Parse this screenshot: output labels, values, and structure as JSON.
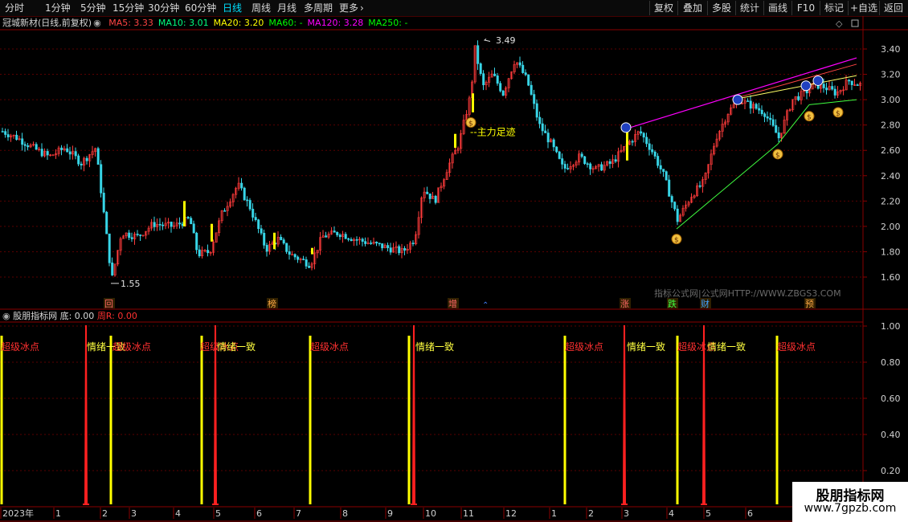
{
  "toolbar": {
    "periods": [
      "分时",
      "1分钟",
      "5分钟",
      "15分钟",
      "30分钟",
      "60分钟",
      "日线",
      "周线",
      "月线",
      "多周期",
      "更多"
    ],
    "active_period": "日线",
    "more_arrow": "›",
    "buttons": [
      "复权",
      "叠加",
      "多股",
      "统计",
      "画线",
      "F10",
      "+自选",
      "返回"
    ],
    "mark_label": "标记"
  },
  "stock": {
    "title": "冠城新材(日线,前复权)",
    "ma": [
      {
        "label": "MA5: 3.33",
        "color": "#ff4444"
      },
      {
        "label": "MA10: 3.01",
        "color": "#00ff80"
      },
      {
        "label": "MA20: 3.20",
        "color": "#ffff00"
      },
      {
        "label": "MA60: -",
        "color": "#00ff00"
      },
      {
        "label": "MA120: 3.28",
        "color": "#ff00ff"
      },
      {
        "label": "MA250: -",
        "color": "#00ff00"
      }
    ]
  },
  "main_axis": {
    "ticks": [
      "3.40",
      "3.20",
      "3.00",
      "2.80",
      "2.60",
      "2.40",
      "2.20",
      "2.00",
      "1.80",
      "1.60"
    ]
  },
  "annotations": {
    "high": "3.49",
    "low": "1.55",
    "main_force": "--主力足迹",
    "watermark": "指标公式网|公式网HTTP://WWW.ZBGS3.COM"
  },
  "events": [
    "回",
    "榜",
    "增",
    "涨",
    "跌",
    "财",
    "预"
  ],
  "indicator": {
    "name": "股朋指标网",
    "label_di": "底: 0.00",
    "label_zhouR": "周R: 0.00",
    "ticks": [
      "1.00",
      "0.80",
      "0.60",
      "0.40",
      "0.20"
    ],
    "signals": [
      "超级冰点",
      "情绪一致",
      "超级冰点",
      "超级冰点",
      "情绪一致",
      "超级冰点",
      "情绪一致",
      "超级冰点",
      "情绪一致",
      "超级冰点",
      "情绪一致",
      "超级冰点"
    ]
  },
  "time_axis": {
    "labels": [
      "2023年",
      "1",
      "2",
      "3",
      "4",
      "5",
      "6",
      "7",
      "8",
      "9",
      "10",
      "11",
      "12",
      "1",
      "2",
      "3",
      "4",
      "5",
      "6"
    ]
  },
  "brand": {
    "line1": "股朋指标网",
    "line2": "www.7gpzb.com"
  },
  "colors": {
    "grid": "#5a0000",
    "frame": "#8a0000",
    "up": "#ff3b3b",
    "down": "#38d6e8",
    "yellow": "#ffff00"
  }
}
